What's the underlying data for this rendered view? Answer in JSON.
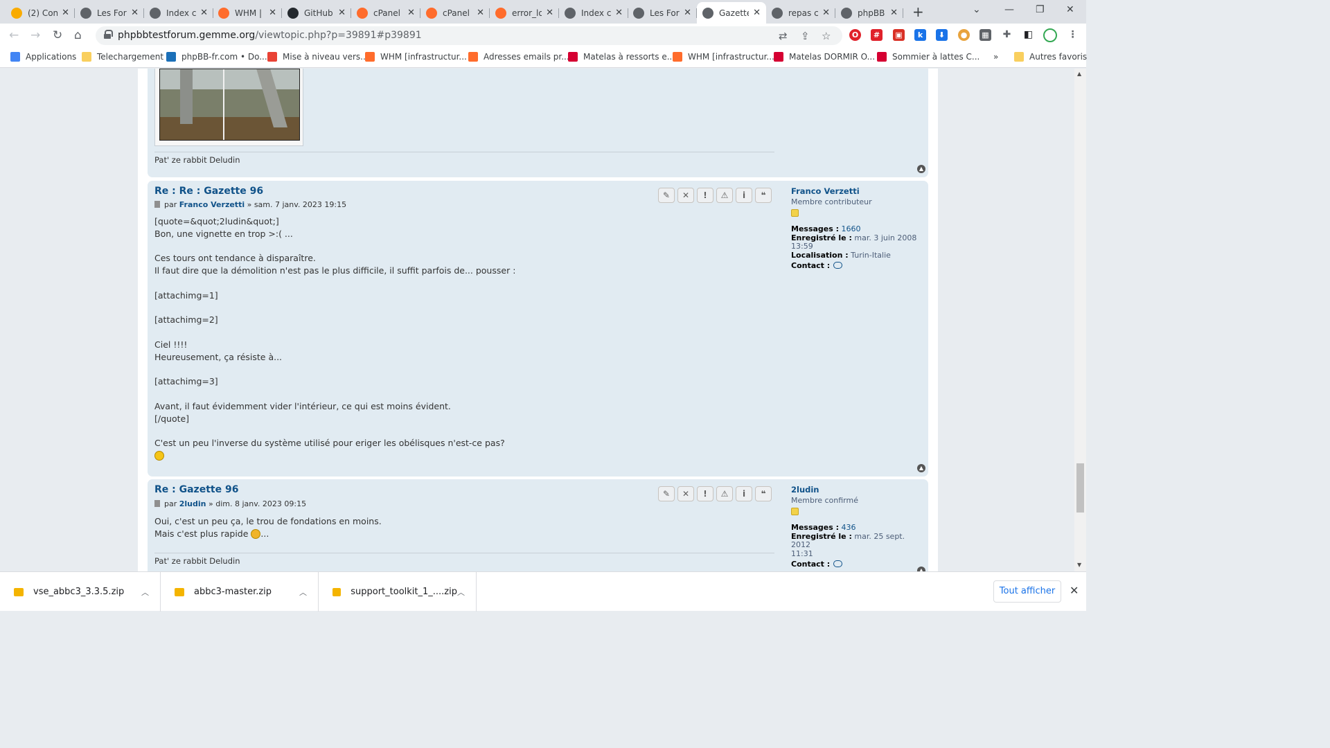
{
  "browser": {
    "tabs": [
      {
        "title": "(2) Con",
        "icon": "robot-favicon",
        "color": "#f9ab00",
        "active": false
      },
      {
        "title": "Les For",
        "icon": "globe-icon",
        "color": "#5f6368",
        "active": false
      },
      {
        "title": "Index c",
        "icon": "globe-icon",
        "color": "#5f6368",
        "active": false
      },
      {
        "title": "WHM |",
        "icon": "cpanel-icon",
        "color": "#ff6c2c",
        "active": false
      },
      {
        "title": "GitHub",
        "icon": "github-icon",
        "color": "#24292e",
        "active": false
      },
      {
        "title": "cPanel",
        "icon": "cpanel-icon",
        "color": "#ff6c2c",
        "active": false
      },
      {
        "title": "cPanel",
        "icon": "cpanel-icon",
        "color": "#ff6c2c",
        "active": false
      },
      {
        "title": "error_lo",
        "icon": "cpanel-icon",
        "color": "#ff6c2c",
        "active": false
      },
      {
        "title": "Index c",
        "icon": "globe-icon",
        "color": "#5f6368",
        "active": false
      },
      {
        "title": "Les For",
        "icon": "globe-icon",
        "color": "#5f6368",
        "active": false
      },
      {
        "title": "Gazette",
        "icon": "globe-icon",
        "color": "#5f6368",
        "active": true
      },
      {
        "title": "repas c",
        "icon": "globe-icon",
        "color": "#5f6368",
        "active": false
      },
      {
        "title": "phpBB",
        "icon": "globe-icon",
        "color": "#5f6368",
        "active": false
      }
    ],
    "url_host": "phpbbtestforum.gemme.org",
    "url_path": "/viewtopic.php?p=39891#p39891",
    "bookmarks": [
      {
        "label": "Applications",
        "icon": "apps-grid-icon",
        "color": "#4285f4"
      },
      {
        "label": "Telechargement",
        "icon": "folder-icon",
        "color": "#f9cf5e"
      },
      {
        "label": "phpBB-fr.com • Do...",
        "icon": "phpbb-icon",
        "color": "#1c70b8"
      },
      {
        "label": "Mise à niveau vers...",
        "icon": "ring-icon",
        "color": "#e94235"
      },
      {
        "label": "WHM [infrastructur...",
        "icon": "cpanel-icon",
        "color": "#ff6c2c"
      },
      {
        "label": "Adresses emails pr...",
        "icon": "mail-icon",
        "color": "#ff6c2c"
      },
      {
        "label": "Matelas à ressorts e...",
        "icon": "house-icon",
        "color": "#d50032"
      },
      {
        "label": "WHM [infrastructur...",
        "icon": "cpanel-icon",
        "color": "#ff6c2c"
      },
      {
        "label": "Matelas DORMIR O...",
        "icon": "conf-icon",
        "color": "#d50032"
      },
      {
        "label": "Sommier à lattes C...",
        "icon": "conf-icon",
        "color": "#d50032"
      },
      {
        "label": "Autres favoris",
        "icon": "folder-icon",
        "color": "#f9cf5e"
      }
    ],
    "more_bookmarks": "»"
  },
  "forum": {
    "previous_post_signature": "Pat' ze rabbit Deludin",
    "posts": [
      {
        "title": "Re : Re : Gazette 96",
        "by": "par",
        "author": "Franco Verzetti",
        "date": "» sam. 7 janv. 2023 19:15",
        "content": "[quote=&quot;2ludin&quot;]\nBon, une vignette en trop >:( ...\n\nCes tours ont tendance à disparaître.\nIl faut dire que la démolition n'est pas le plus difficile, il suffit parfois de... pousser :\n\n[attachimg=1]\n\n[attachimg=2]\n\nCiel !!!!\nHeureusement, ça résiste à...\n\n[attachimg=3]\n\nAvant, il faut évidemment vider l'intérieur, ce qui est moins évident.\n[/quote]\n\nC'est un peu l'inverse du système utilisé pour eriger les obélisques n'est-ce pas?",
        "profile": {
          "username": "Franco Verzetti",
          "rank": "Membre contributeur",
          "messages_label": "Messages :",
          "messages": "1660",
          "joined_label": "Enregistré le :",
          "joined": "mar. 3 juin 2008 13:59",
          "location_label": "Localisation :",
          "location": "Turin-Italie",
          "contact_label": "Contact :"
        }
      },
      {
        "title": "Re : Gazette 96",
        "by": "par",
        "author": "2ludin",
        "date": "» dim. 8 janv. 2023 09:15",
        "content_line1": "Oui, c'est un peu ça, le trou de fondations en moins.",
        "content_line2_prefix": "Mais c'est plus rapide",
        "content_line2_suffix": "...",
        "signature": "Pat' ze rabbit Deludin",
        "profile": {
          "username": "2ludin",
          "rank": "Membre confirmé",
          "messages_label": "Messages :",
          "messages": "436",
          "joined_label": "Enregistré le :",
          "joined": "mar. 25 sept. 2012",
          "joined_time": "11:31",
          "contact_label": "Contact :"
        }
      }
    ],
    "post_buttons": [
      {
        "name": "edit-button",
        "icon": "pencil-icon",
        "glyph": "✎"
      },
      {
        "name": "delete-button",
        "icon": "close-icon",
        "glyph": "✕"
      },
      {
        "name": "report-button",
        "icon": "exclamation-icon",
        "glyph": "!"
      },
      {
        "name": "warn-button",
        "icon": "warning-icon",
        "glyph": "⚠"
      },
      {
        "name": "info-button",
        "icon": "info-icon",
        "glyph": "i"
      },
      {
        "name": "quote-button",
        "icon": "quote-icon",
        "glyph": "❝"
      }
    ]
  },
  "downloads": {
    "items": [
      "vse_abbc3_3.3.5.zip",
      "abbc3-master.zip",
      "support_toolkit_1_....zip"
    ],
    "show_all": "Tout afficher"
  }
}
